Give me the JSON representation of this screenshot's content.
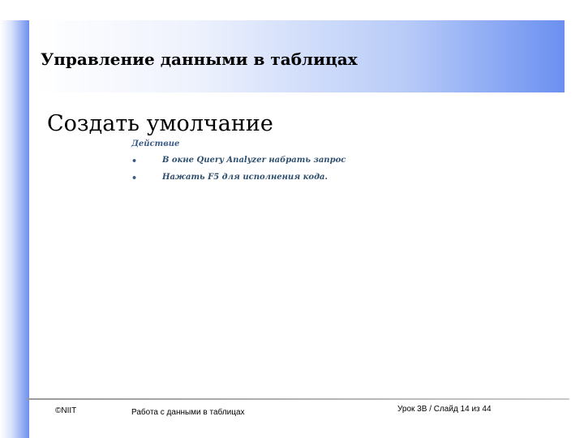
{
  "title": "Управление данными в таблицах",
  "subtitle": "Создать умолчание",
  "section_label": "Действие",
  "bullets": [
    {
      "symbol": "•",
      "text": "В окне Query Analyzer набрать запрос"
    },
    {
      "symbol": "•",
      "text": "Нажать F5 для исполнения кода."
    }
  ],
  "footer": {
    "copyright": "©NIIT",
    "course": "Работа с данными в таблицах",
    "slide_info": "Урок 3В / Слайд 14 из 44"
  },
  "colors": {
    "accent_blue": "#6b90f0",
    "bullet_text": "#2f4f6e"
  }
}
